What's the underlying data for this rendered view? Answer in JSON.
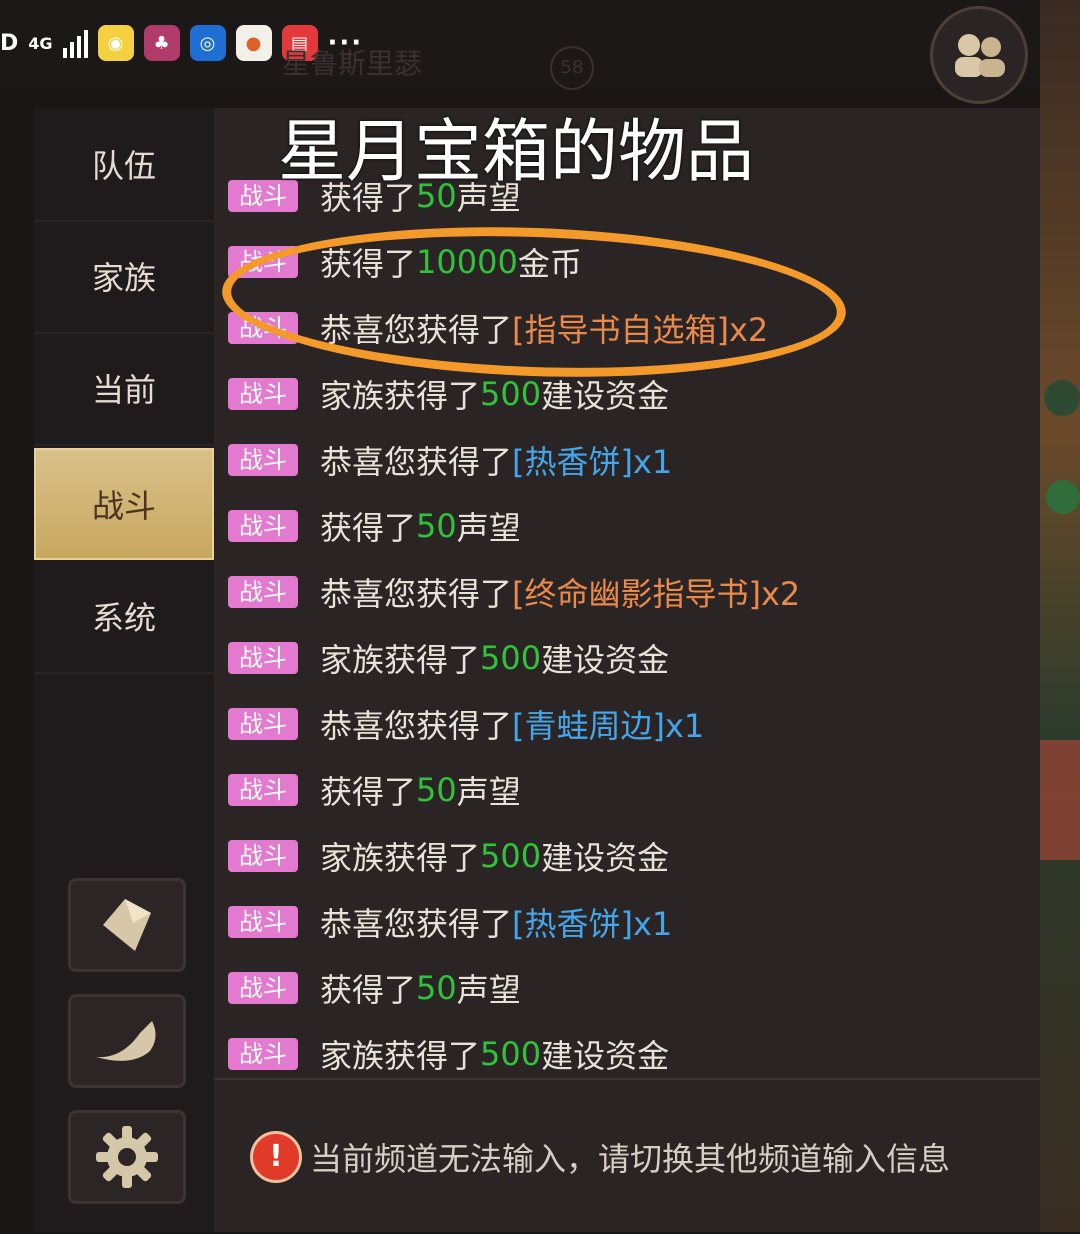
{
  "status_bar": {
    "left_text": "D",
    "network": "4G",
    "dots": "···"
  },
  "background": {
    "player_name": "星鲁斯里瑟",
    "level": "58"
  },
  "annotation": {
    "title": "星月宝箱的物品"
  },
  "nav": {
    "items": [
      {
        "label": "队伍"
      },
      {
        "label": "家族"
      },
      {
        "label": "当前"
      },
      {
        "label": "战斗",
        "active": true
      },
      {
        "label": "系统"
      }
    ]
  },
  "tag_label": "战斗",
  "chat": {
    "messages": [
      {
        "pre": "获得了",
        "hl": "50",
        "hl_color": "green",
        "post": "声望"
      },
      {
        "pre": "获得了",
        "hl": "10000",
        "hl_color": "green",
        "post": "金币"
      },
      {
        "pre": "恭喜您获得了",
        "hl": "[指导书自选箱]x2",
        "hl_color": "orange",
        "post": ""
      },
      {
        "pre": "家族获得了",
        "hl": "500",
        "hl_color": "green",
        "post": "建设资金"
      },
      {
        "pre": "恭喜您获得了",
        "hl": "[热香饼]x1",
        "hl_color": "blue",
        "post": ""
      },
      {
        "pre": "获得了",
        "hl": "50",
        "hl_color": "green",
        "post": "声望"
      },
      {
        "pre": "恭喜您获得了",
        "hl": "[终命幽影指导书]x2",
        "hl_color": "orange",
        "post": ""
      },
      {
        "pre": "家族获得了",
        "hl": "500",
        "hl_color": "green",
        "post": "建设资金"
      },
      {
        "pre": "恭喜您获得了",
        "hl": "[青蛙周边]x1",
        "hl_color": "blue",
        "post": ""
      },
      {
        "pre": "获得了",
        "hl": "50",
        "hl_color": "green",
        "post": "声望"
      },
      {
        "pre": "家族获得了",
        "hl": "500",
        "hl_color": "green",
        "post": "建设资金"
      },
      {
        "pre": "恭喜您获得了",
        "hl": "[热香饼]x1",
        "hl_color": "blue",
        "post": ""
      },
      {
        "pre": "获得了",
        "hl": "50",
        "hl_color": "green",
        "post": "声望"
      },
      {
        "pre": "家族获得了",
        "hl": "500",
        "hl_color": "green",
        "post": "建设资金"
      }
    ],
    "input_notice": "当前频道无法输入，请切换其他频道输入信息"
  },
  "colors": {
    "tag": "#e37ad0",
    "green": "#30c23a",
    "blue": "#44a6e8",
    "orange": "#e9894a",
    "annotation": "#f49a2a"
  }
}
